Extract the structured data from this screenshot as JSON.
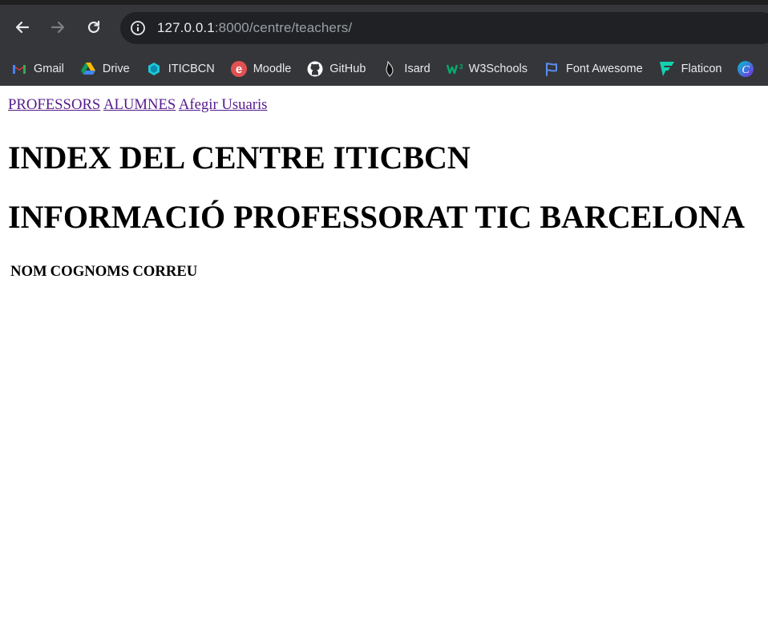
{
  "browser": {
    "url_host": "127.0.0.1",
    "url_rest": ":8000/centre/teachers/",
    "bookmarks": [
      {
        "label": "Gmail",
        "icon": "gmail-icon"
      },
      {
        "label": "Drive",
        "icon": "drive-icon"
      },
      {
        "label": "ITICBCN",
        "icon": "iticbcn-icon"
      },
      {
        "label": "Moodle",
        "icon": "moodle-icon"
      },
      {
        "label": "GitHub",
        "icon": "github-icon"
      },
      {
        "label": "Isard",
        "icon": "isard-icon"
      },
      {
        "label": "W3Schools",
        "icon": "w3schools-icon"
      },
      {
        "label": "Font Awesome",
        "icon": "fontawesome-icon"
      },
      {
        "label": "Flaticon",
        "icon": "flaticon-icon"
      }
    ],
    "colors": {
      "frame": "#35363a",
      "omnibox": "#202124",
      "text": "#e8eaed"
    }
  },
  "nav": {
    "professors": "PROFESSORS",
    "alumnes": "ALUMNES",
    "afegir": "Afegir Usuaris"
  },
  "headings": {
    "main": "INDEX DEL CENTRE ITICBCN",
    "sub": "INFORMACIÓ PROFESSORAT TIC BARCELONA"
  },
  "table": {
    "columns": [
      "NOM",
      "COGNOMS",
      "CORREU"
    ]
  }
}
